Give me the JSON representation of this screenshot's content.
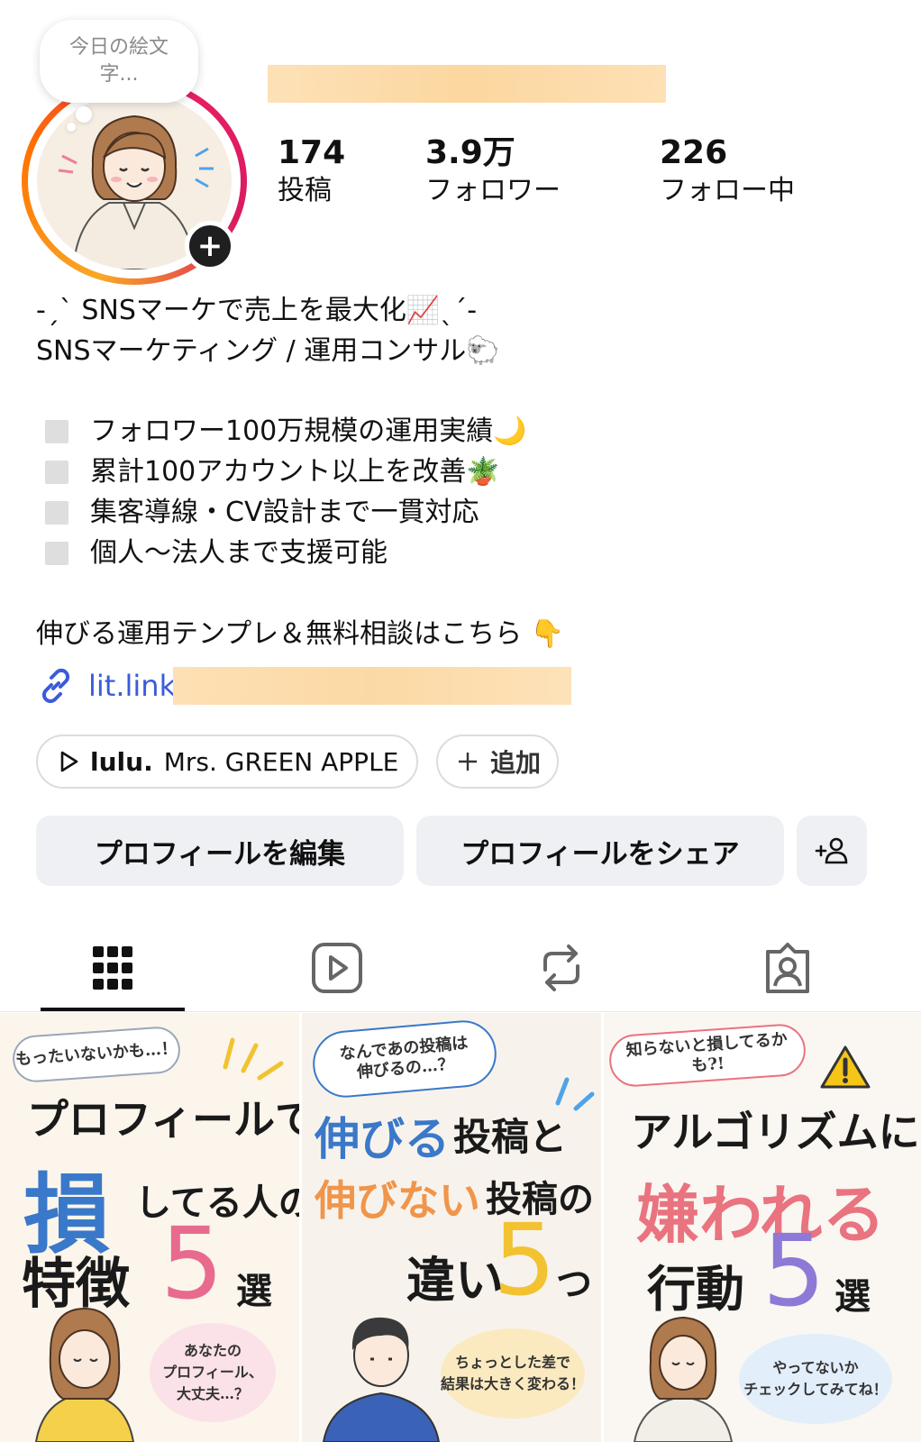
{
  "note": {
    "text": "今日の絵文字..."
  },
  "stats": [
    {
      "value": "174",
      "label": "投稿"
    },
    {
      "value": "3.9万",
      "label": "フォロワー"
    },
    {
      "value": "226",
      "label": "フォロー中"
    }
  ],
  "bio": {
    "line1": "-ˏˋ SNSマーケで売上を最大化📈ˎˊ-",
    "line2": "SNSマーケティング / 運用コンサル🐑",
    "bullets": [
      "フォロワー100万規模の運用実績🌙",
      "累計100アカウント以上を改善🪴",
      "集客導線・CV設計まで一貫対応",
      "個人〜法人まで支援可能"
    ],
    "cta": "伸びる運用テンプレ＆無料相談はこちら 👇",
    "link": "lit.link"
  },
  "chips": {
    "music_title": "lulu.",
    "music_artist": "Mrs. GREEN APPLE",
    "add_label": "追加"
  },
  "buttons": {
    "edit": "プロフィールを編集",
    "share": "プロフィールをシェア"
  },
  "tabs": [
    {
      "icon": "grid-icon",
      "active": true
    },
    {
      "icon": "reels-icon",
      "active": false
    },
    {
      "icon": "repost-icon",
      "active": false
    },
    {
      "icon": "tagged-icon",
      "active": false
    }
  ],
  "posts": [
    {
      "bubble": "もったいないかも…！",
      "title_a": "プロフィールで",
      "title_b_big": "損",
      "title_b_rest": "してる人の",
      "title_c": "特徴",
      "number": "5",
      "suffix": "選",
      "footer": "あなたの\nプロフィール、\n大丈夫…？",
      "accent": "#3a78c9",
      "number_color": "#e86a8e"
    },
    {
      "bubble": "なんであの投稿は\n伸びるの…？",
      "title_a_hl": "伸びる",
      "title_a_rest": "投稿と",
      "title_b_hl": "伸びない",
      "title_b_rest": "投稿の",
      "title_c": "違い",
      "number": "5",
      "suffix": "つ",
      "footer": "ちょっとした差で\n結果は大きく変わる！",
      "accent": "#3a78c9",
      "accent2": "#f0954a",
      "number_color": "#f2c230"
    },
    {
      "bubble": "知らないと損してるかも?!",
      "title_a": "アルゴリズムに",
      "title_b": "嫌われる",
      "title_c": "行動",
      "number": "5",
      "suffix": "選",
      "footer": "やってないか\nチェックしてみてね！",
      "accent": "#e9737f",
      "number_color": "#8f79d6"
    }
  ]
}
